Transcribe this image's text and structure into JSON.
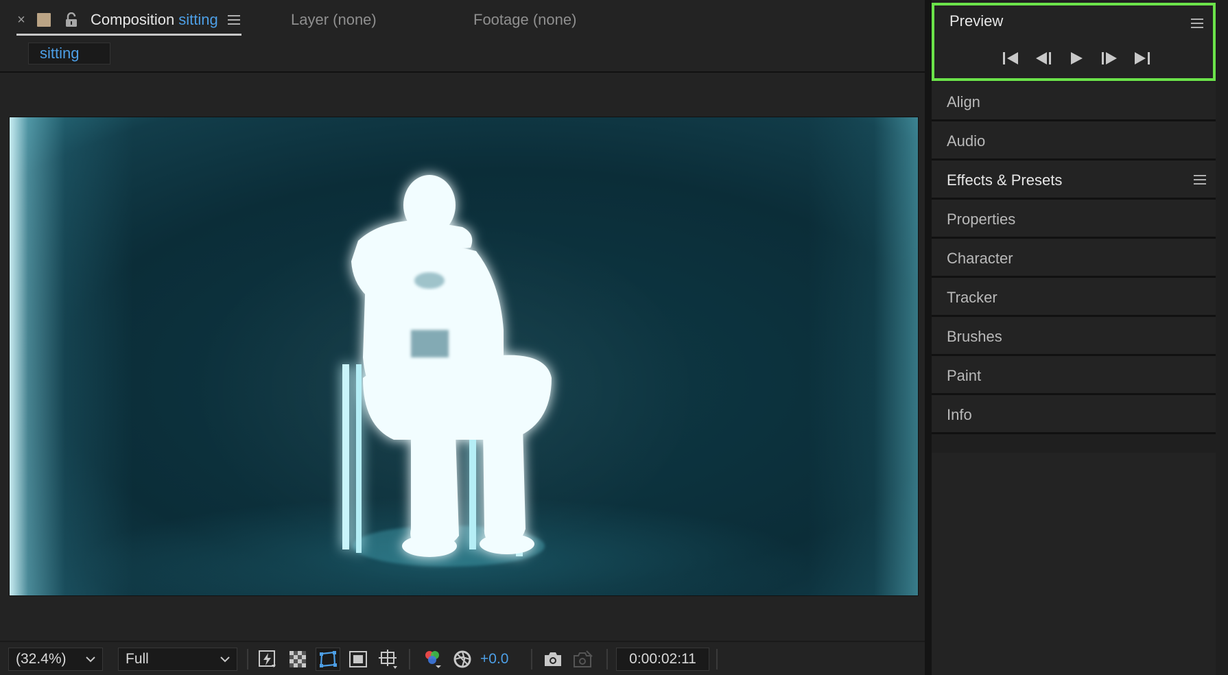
{
  "composition_panel": {
    "tabs": {
      "close_glyph": "×",
      "composition_label": "Composition",
      "composition_name": "sitting",
      "layer_tab": "Layer (none)",
      "footage_tab": "Footage (none)"
    },
    "breadcrumb": "sitting",
    "colors": {
      "accent_blue": "#4d9fe6",
      "label_swatch": "#bba485"
    }
  },
  "viewer_toolbar": {
    "zoom_value": "(32.4%)",
    "resolution_value": "Full",
    "exposure_value": "+0.0",
    "timecode": "0:00:02:11",
    "icons": [
      "fast-previews-icon",
      "transparency-grid-icon",
      "mask-visibility-icon",
      "region-of-interest-icon",
      "grid-guides-icon",
      "color-channels-icon",
      "color-management-icon",
      "snapshot-icon",
      "show-snapshot-icon"
    ]
  },
  "right_panel": {
    "preview": {
      "title": "Preview",
      "highlight_color": "#6be34a",
      "controls": [
        "first-frame-icon",
        "previous-frame-icon",
        "play-icon",
        "next-frame-icon",
        "last-frame-icon"
      ]
    },
    "panels": [
      {
        "label": "Align"
      },
      {
        "label": "Audio"
      },
      {
        "label": "Effects & Presets",
        "expanded": true
      },
      {
        "label": "Properties"
      },
      {
        "label": "Character"
      },
      {
        "label": "Tracker"
      },
      {
        "label": "Brushes"
      },
      {
        "label": "Paint"
      },
      {
        "label": "Info"
      }
    ]
  }
}
